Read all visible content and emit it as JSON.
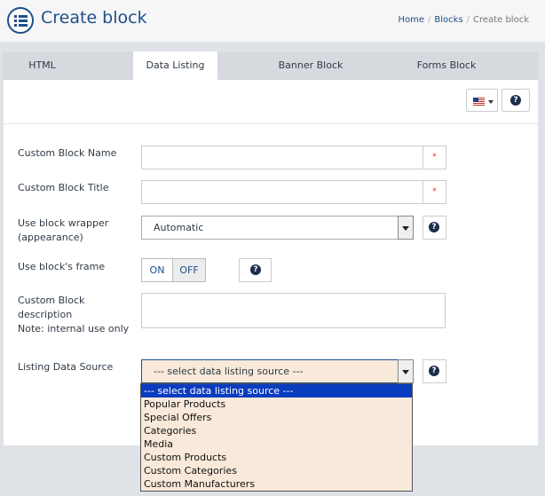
{
  "header": {
    "title": "Create block",
    "breadcrumb": [
      "Home",
      "Blocks",
      "Create block"
    ]
  },
  "tabs": [
    {
      "label": "HTML",
      "active": false
    },
    {
      "label": "Data Listing",
      "active": true
    },
    {
      "label": "Banner Block",
      "active": false
    },
    {
      "label": "Forms Block",
      "active": false
    }
  ],
  "toolbar": {
    "language_flag": "us-flag-icon",
    "help_icon": "?"
  },
  "form": {
    "name_label": "Custom Block Name",
    "name_value": "",
    "name_required": "*",
    "title_label": "Custom Block Title",
    "title_value": "",
    "title_required": "*",
    "wrapper_label_line1": "Use block wrapper",
    "wrapper_label_line2": "(appearance)",
    "wrapper_value": "Automatic",
    "frame_label": "Use block's frame",
    "frame_on": "ON",
    "frame_off": "OFF",
    "frame_selected": "OFF",
    "desc_label_line1": "Custom Block",
    "desc_label_line2": "description",
    "desc_label_line3": "Note: internal use only",
    "desc_value": "",
    "source_label": "Listing Data Source",
    "source_value": "--- select data listing source ---",
    "help_glyph": "?"
  },
  "source_options": [
    "--- select data listing source ---",
    "Popular Products",
    "Special Offers",
    "Categories",
    "Media",
    "Custom Products",
    "Custom Categories",
    "Custom Manufacturers"
  ],
  "colors": {
    "accent": "#1e4f8b",
    "required": "#d0302c",
    "dropdown_bg": "#f8e9da",
    "selected_option": "#0a3cc0"
  }
}
